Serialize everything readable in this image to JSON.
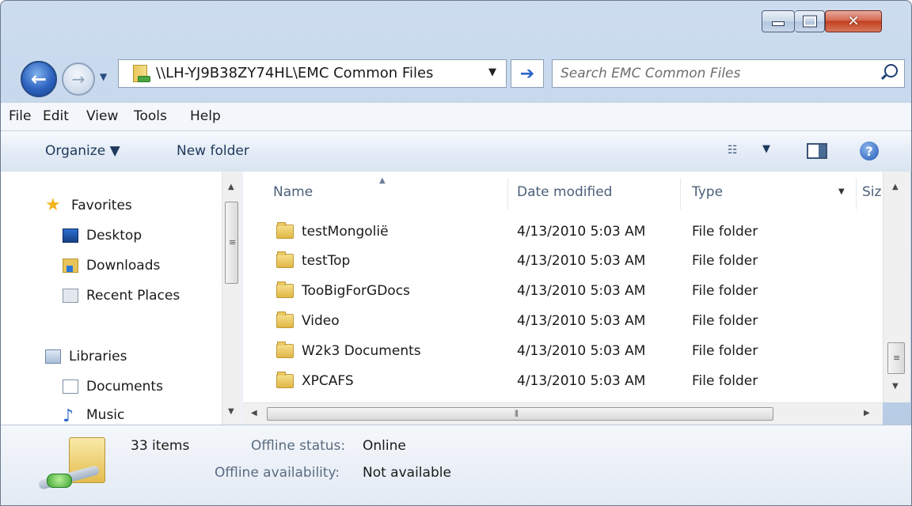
{
  "title_controls": {
    "minimize_icon": "minimize-icon",
    "maximize_icon": "maximize-icon",
    "close_glyph": "✕"
  },
  "nav": {
    "back_glyph": "←",
    "forward_glyph": "→",
    "recent_glyph": "▼"
  },
  "address": {
    "path": "\\\\LH-YJ9B38ZY74HL\\EMC Common Files",
    "dropdown_glyph": "▼",
    "go_glyph": "➔"
  },
  "search": {
    "placeholder": "Search EMC Common Files"
  },
  "menu": {
    "file": "File",
    "edit": "Edit",
    "view": "View",
    "tools": "Tools",
    "help": "Help"
  },
  "commands": {
    "organize": "Organize ▼",
    "new_folder": "New folder",
    "views_dd": "▼",
    "help_glyph": "?"
  },
  "nav_pane": {
    "favorites": "Favorites",
    "desktop": "Desktop",
    "downloads": "Downloads",
    "recent_places": "Recent Places",
    "libraries": "Libraries",
    "documents": "Documents",
    "music": "Music"
  },
  "columns": {
    "name": "Name",
    "date_modified": "Date modified",
    "type": "Type",
    "size": "Siz",
    "type_dd": "▼"
  },
  "files": [
    {
      "name": "testMongolië",
      "date": "4/13/2010 5:03 AM",
      "type": "File folder"
    },
    {
      "name": "testTop",
      "date": "4/13/2010 5:03 AM",
      "type": "File folder"
    },
    {
      "name": "TooBigForGDocs",
      "date": "4/13/2010 5:03 AM",
      "type": "File folder"
    },
    {
      "name": "Video",
      "date": "4/13/2010 5:03 AM",
      "type": "File folder"
    },
    {
      "name": "W2k3 Documents",
      "date": "4/13/2010 5:03 AM",
      "type": "File folder"
    },
    {
      "name": "XPCAFS",
      "date": "4/13/2010 5:03 AM",
      "type": "File folder"
    }
  ],
  "details": {
    "count": "33 items",
    "offline_status_label": "Offline status:",
    "offline_status_value": "Online",
    "offline_availability_label": "Offline availability:",
    "offline_availability_value": "Not available"
  }
}
